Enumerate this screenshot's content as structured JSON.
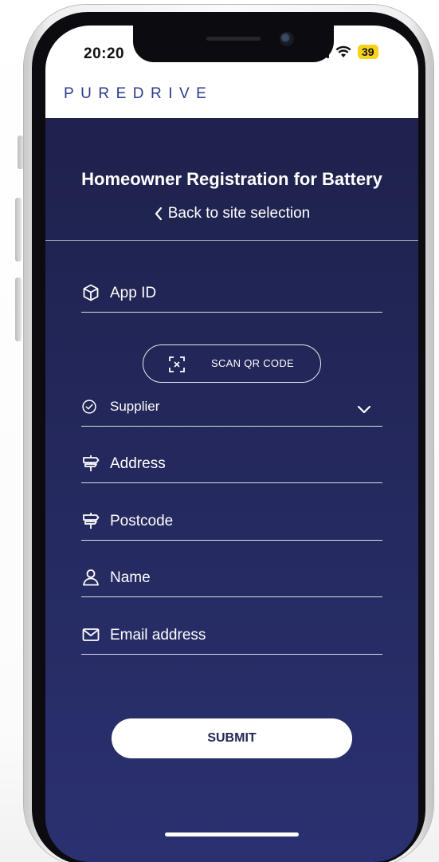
{
  "status_bar": {
    "time": "20:20",
    "battery": "39"
  },
  "header": {
    "brand": "PUREDRIVE"
  },
  "page": {
    "title": "Homeowner Registration for Battery",
    "back_link": "Back to site selection"
  },
  "form": {
    "app_id": "App ID",
    "scan_button": "SCAN QR CODE",
    "supplier": "Supplier",
    "address": "Address",
    "postcode": "Postcode",
    "name": "Name",
    "email": "Email address",
    "submit": "SUBMIT"
  },
  "icons": {
    "app_id": "box-icon",
    "scan": "qr-scan-icon",
    "supplier": "check-circle-icon",
    "supplier_dropdown": "chevron-down-icon",
    "address": "signpost-icon",
    "postcode": "signpost-icon",
    "name": "user-icon",
    "email": "mail-icon",
    "back": "chevron-left-icon"
  },
  "colors": {
    "background": "#23275a",
    "brand": "#2c3a8a",
    "battery_badge": "#f5d21c"
  }
}
